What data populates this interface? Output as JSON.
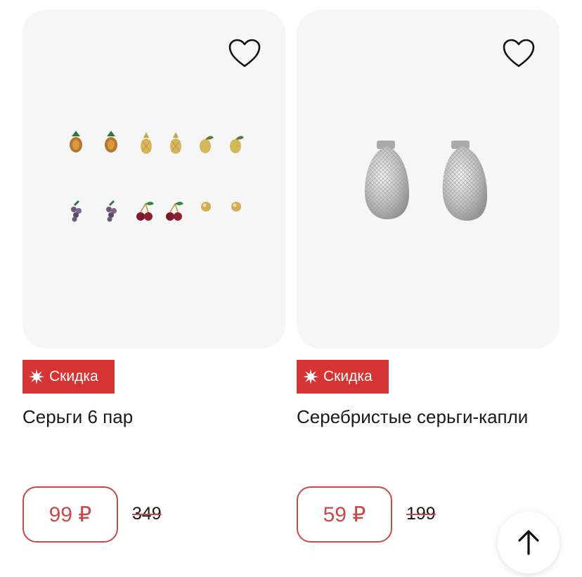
{
  "products": [
    {
      "badge": "Скидка",
      "title": "Серьги 6 пар",
      "price": "99 ₽",
      "old_price": "349"
    },
    {
      "badge": "Скидка",
      "title": "Серебристые серьги-капли",
      "price": "59 ₽",
      "old_price": "199"
    }
  ],
  "colors": {
    "accent": "#d63434",
    "price": "#c9484a",
    "card_bg": "#f6f6f6"
  },
  "icons": [
    "heart-icon",
    "sparkle-icon",
    "arrow-up-icon"
  ]
}
